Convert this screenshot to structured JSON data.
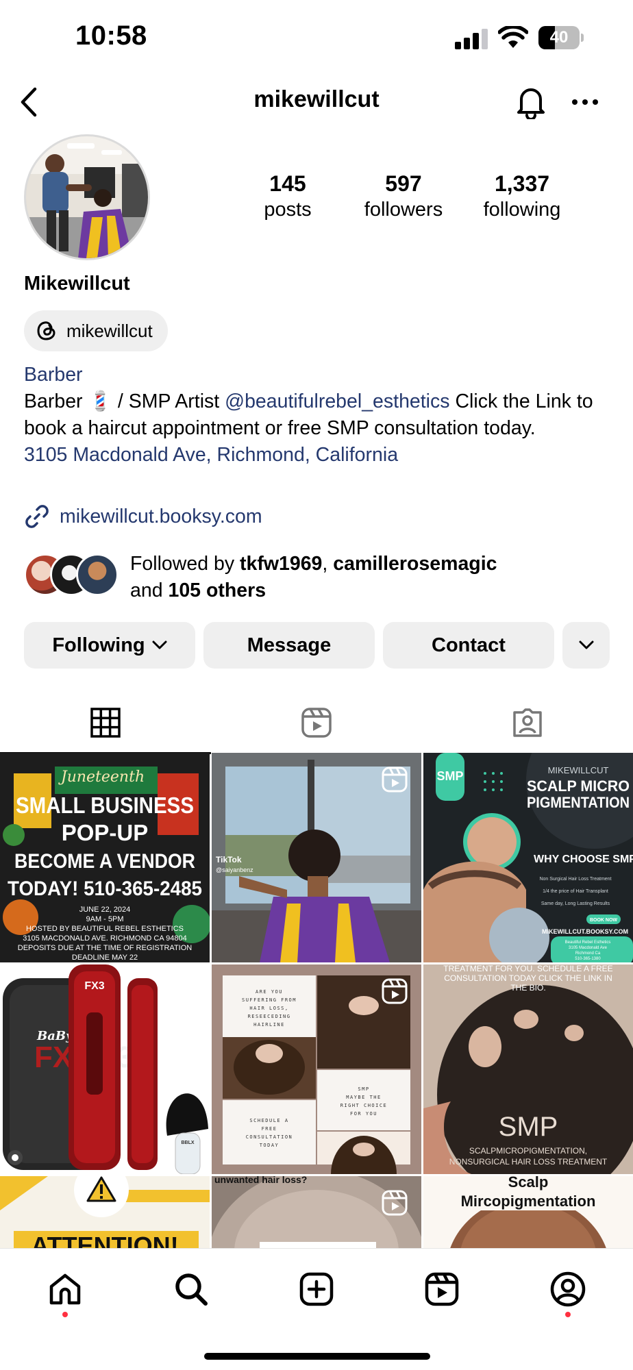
{
  "status_bar": {
    "time": "10:58",
    "battery": "40",
    "battery_level": 0.4
  },
  "header": {
    "username": "mikewillcut",
    "icons": [
      "chevron-left-icon",
      "bell-icon",
      "more-horizontal-icon"
    ]
  },
  "profile": {
    "stats": [
      {
        "value": "145",
        "label": "posts"
      },
      {
        "value": "597",
        "label": "followers"
      },
      {
        "value": "1,337",
        "label": "following"
      }
    ],
    "display_name": "Mikewillcut",
    "threads_handle": "mikewillcut",
    "bio": {
      "category": "Barber",
      "line_start": "Barber 💈 / SMP Artist ",
      "mention": "@beautifulrebel_esthetics",
      "line_rest": " Click the Link to book a haircut appointment or free SMP consultation today.",
      "address": "3105 Macdonald Ave, Richmond, California"
    },
    "link": "mikewillcut.booksy.com",
    "followed_by": {
      "prefix": "Followed by ",
      "user1": "tkfw1969",
      "separator": ", ",
      "user2": "camillerosemagic",
      "and_text": "and ",
      "others": "105 others"
    }
  },
  "actions": {
    "following": "Following",
    "message": "Message",
    "contact": "Contact"
  },
  "tabs": [
    "grid-icon",
    "reels-icon",
    "tagged-icon"
  ],
  "posts": {
    "p1": {
      "script": "Juneteenth",
      "l1": "SMALL BUSINESS",
      "l2": "POP-UP",
      "l3": "BECOME A VENDOR",
      "l4": "TODAY! 510-365-2485",
      "date": "JUNE 22, 2024",
      "time": "9AM - 5PM",
      "host": "HOSTED BY BEAUTIFUL REBEL ESTHETICS",
      "addr": "3105 MACDONALD AVE. RICHMOND CA 94804",
      "dep": "DEPOSITS DUE AT THE TIME OF REGISTRATION",
      "deadline": "DEADLINE MAY 22"
    },
    "p2": {
      "tiktok": "TikTok",
      "handle": "@saiyanbenz"
    },
    "p3": {
      "tag": "SMP",
      "brand": "MIKEWILLCUT",
      "t1": "SCALP MICRO",
      "t2": "PIGMENTATION",
      "why": "WHY CHOOSE SMP",
      "b1": "Non Surgical Hair Loss Treatment",
      "b2": "1/4 the price of Hair Transplant",
      "b3": "Same day, Long Lasting Results",
      "book": "BOOK NOW",
      "site": "MIKEWILLCUT.BOOKSY.COM",
      "a1": "Beautiful Rebel Esthetics",
      "a2": "3105 Macdonald Ave",
      "a3": "Richmond Ca",
      "a4": "510-365-1380"
    },
    "p4": {
      "brand": "BaBylis",
      "model": "FX3",
      "logo": "FX",
      "num": "3",
      "badge": "BBLX"
    },
    "p5": {
      "c1": [
        "ARE YOU",
        "SUFFERING FROM",
        "HAIR LOSS,",
        "RESEECEDING",
        "HAIRLINE"
      ],
      "c2": [
        "SMP",
        "MAYBE THE",
        "RIGHT CHOICE",
        "FOR YOU"
      ],
      "c3": [
        "SCHEDULE A",
        "FREE",
        "CONSULTATION",
        "TODAY"
      ]
    },
    "p6": {
      "top1": "TREATMENT FOR YOU. SCHEDULE A FREE",
      "top2": "CONSULTATION TODAY CLICK THE LINK IN",
      "top3": "THE BIO.",
      "big": "SMP",
      "sub1": "SCALPMICROPIGMENTATION,",
      "sub2": "NONSURGICAL HAIR LOSS TREATMENT"
    },
    "p7": {
      "text": "ATTENTION!"
    },
    "p8": {
      "text": "unwanted hair loss?"
    },
    "p9": {
      "t1": "Scalp",
      "t2": "Mircopigmentation"
    }
  },
  "bottom_nav": [
    "home-icon",
    "search-icon",
    "create-icon",
    "reels-icon",
    "profile-icon"
  ],
  "colors": {
    "link": "#24386e",
    "button_bg": "#efefef",
    "notification_dot": "#ff3040"
  }
}
